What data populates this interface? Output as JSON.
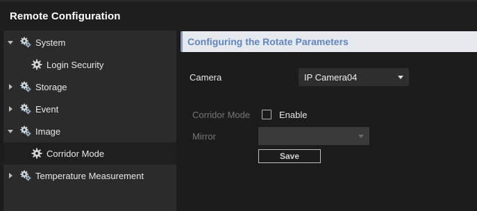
{
  "window": {
    "title": "Remote Configuration"
  },
  "sidebar": {
    "items": [
      {
        "label": "System",
        "level": 0,
        "expanded": true,
        "selected": false
      },
      {
        "label": "Login Security",
        "level": 1,
        "selected": false
      },
      {
        "label": "Storage",
        "level": 0,
        "expanded": false,
        "selected": false
      },
      {
        "label": "Event",
        "level": 0,
        "expanded": false,
        "selected": false
      },
      {
        "label": "Image",
        "level": 0,
        "expanded": true,
        "selected": false
      },
      {
        "label": "Corridor Mode",
        "level": 1,
        "selected": true
      },
      {
        "label": "Temperature Measurement",
        "level": 0,
        "expanded": false,
        "selected": false
      }
    ]
  },
  "main": {
    "section_title": "Configuring the Rotate Parameters",
    "camera": {
      "label": "Camera",
      "selected_value": "IP Camera04"
    },
    "corridor_mode": {
      "label": "Corridor Mode",
      "checkbox_label": "Enable",
      "checked": false,
      "enabled": false
    },
    "mirror": {
      "label": "Mirror",
      "selected_value": "",
      "enabled": false
    },
    "save_label": "Save"
  },
  "colors": {
    "background": "#1c1c1c",
    "sidebar_bg": "#2b2b2b",
    "selected_bg": "#1f1f1f",
    "header_bg": "#e6e9ee",
    "header_text": "#5f86bd",
    "disabled_text": "#777777"
  }
}
